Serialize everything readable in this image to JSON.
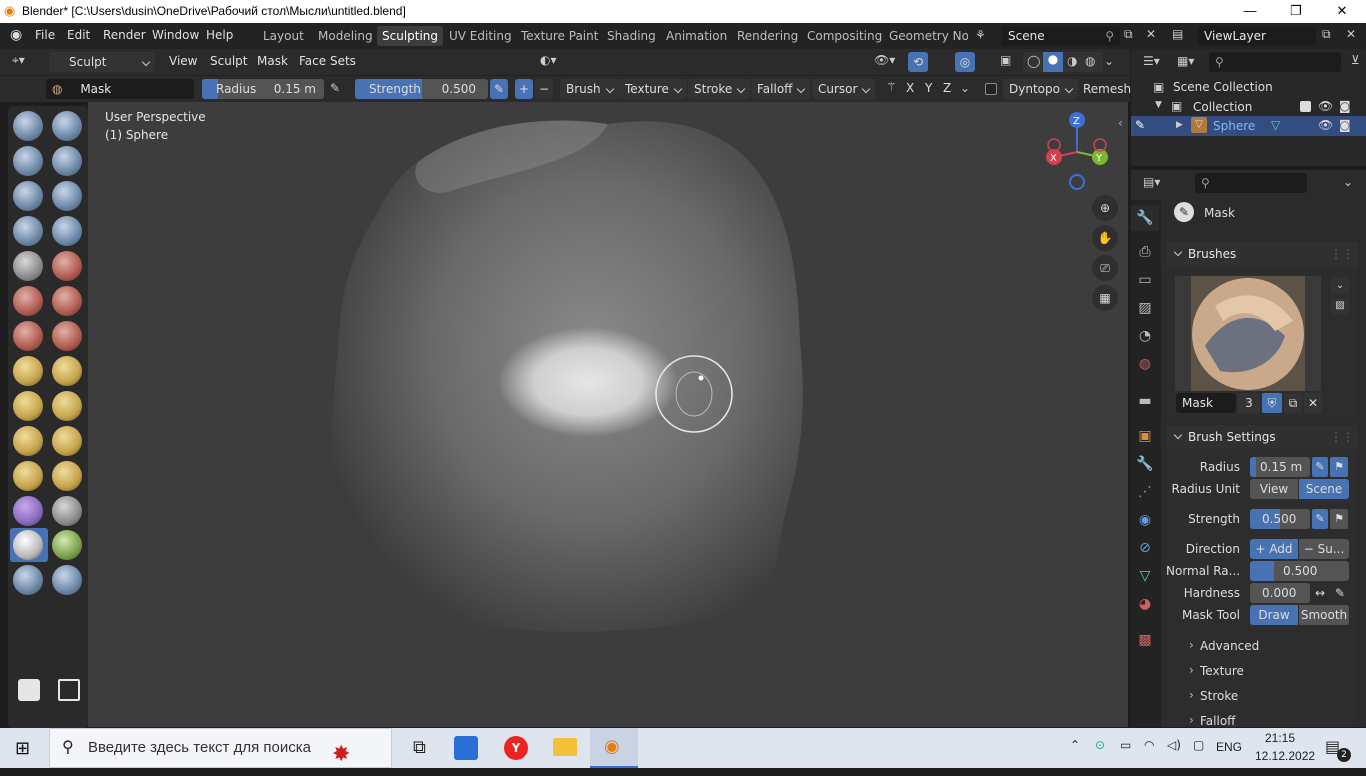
{
  "titlebar": {
    "text": "Blender* [C:\\Users\\dusin\\OneDrive\\Рабочий стол\\Мысли\\untitled.blend]",
    "minimize": "—",
    "maximize": "❐",
    "close": "✕"
  },
  "menus": [
    "File",
    "Edit",
    "Render",
    "Window",
    "Help"
  ],
  "workspaces": [
    "Layout",
    "Modeling",
    "Sculpting",
    "UV Editing",
    "Texture Paint",
    "Shading",
    "Animation",
    "Rendering",
    "Compositing",
    "Geometry Noc"
  ],
  "active_workspace": "Sculpting",
  "scene": "Scene",
  "view_layer": "ViewLayer",
  "header": {
    "mode": "Sculpt Mode",
    "menus": [
      "View",
      "Sculpt",
      "Mask",
      "Face Sets"
    ]
  },
  "toolsettings": {
    "brush_name": "Mask",
    "radius_label": "Radius",
    "radius_value": "0.15 m",
    "strength_label": "Strength",
    "strength_value": "0.500",
    "strength_fraction": 0.5,
    "dropdowns": [
      "Brush",
      "Texture",
      "Stroke",
      "Falloff",
      "Cursor"
    ],
    "axes": [
      "X",
      "Y",
      "Z"
    ],
    "dyntopo": "Dyntopo",
    "remesh": "Remesh"
  },
  "viewport": {
    "perspective": "User Perspective",
    "object": "(1) Sphere"
  },
  "gizmo": {
    "z": "Z",
    "x": "X",
    "y": "Y"
  },
  "outliner": {
    "root": "Scene Collection",
    "collection": "Collection",
    "object": "Sphere"
  },
  "properties": {
    "brush_header": "Mask",
    "brushes_panel": "Brushes",
    "brush_name": "Mask",
    "brush_users": "3",
    "settings_panel": "Brush Settings",
    "radius_label": "Radius",
    "radius_value": "0.15 m",
    "radius_unit_label": "Radius Unit",
    "radius_unit_view": "View",
    "radius_unit_scene": "Scene",
    "strength_label": "Strength",
    "strength_value": "0.500",
    "direction_label": "Direction",
    "direction_add": "Add",
    "direction_sub": "Su...",
    "normal_label": "Normal Ra...",
    "normal_value": "0.500",
    "hardness_label": "Hardness",
    "hardness_value": "0.000",
    "masktool_label": "Mask Tool",
    "masktool_draw": "Draw",
    "masktool_smooth": "Smooth",
    "subpanels": [
      "Advanced",
      "Texture",
      "Stroke",
      "Falloff"
    ]
  },
  "taskbar": {
    "search_placeholder": "Введите здесь текст для поиска",
    "time": "21:15",
    "date": "12.12.2022",
    "lang": "ENG",
    "notif": "2"
  },
  "colors": {
    "accent": "#4772b3",
    "active_object": "#4772b3"
  }
}
